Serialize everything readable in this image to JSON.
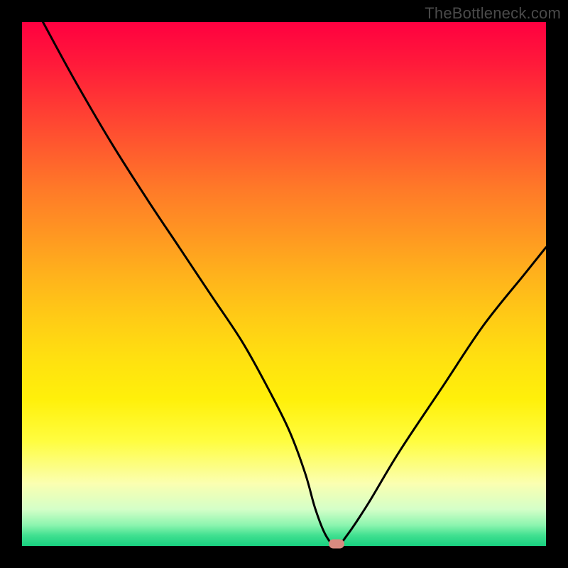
{
  "watermark": "TheBottleneck.com",
  "chart_data": {
    "type": "line",
    "title": "",
    "xlabel": "",
    "ylabel": "",
    "xlim": [
      0,
      100
    ],
    "ylim": [
      0,
      100
    ],
    "grid": false,
    "legend": false,
    "background_gradient": {
      "top": "#ff0040",
      "mid": "#ffe010",
      "bottom": "#18d080"
    },
    "series": [
      {
        "name": "bottleneck-curve",
        "x": [
          4,
          10,
          17,
          24,
          30,
          36,
          42,
          47,
          51,
          54,
          56,
          58,
          60,
          62,
          66,
          72,
          80,
          88,
          96,
          100
        ],
        "y": [
          100,
          89,
          77,
          66,
          57,
          48,
          39,
          30,
          22,
          14,
          7,
          2,
          0,
          2,
          8,
          18,
          30,
          42,
          52,
          57
        ]
      }
    ],
    "marker": {
      "x": 60,
      "y": 0,
      "color": "#d88a80"
    }
  }
}
